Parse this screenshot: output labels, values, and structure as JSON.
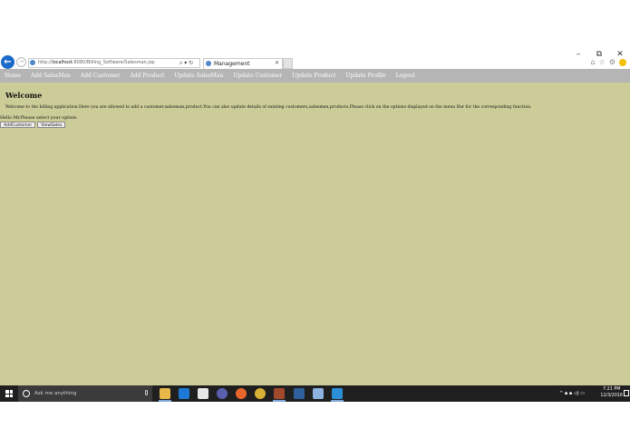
{
  "window_controls": {
    "minimize": "–",
    "restore": "⧉",
    "close": "✕"
  },
  "browser": {
    "back_icon": "←",
    "forward_icon": "→",
    "url_prefix": "http://",
    "url_host": "localhost",
    "url_rest": ":8080/Billing_Software/Salesman.jsp",
    "addr_actions": "⌕ ▾ ↻",
    "tab_title": "Management",
    "tab_close": "✕",
    "right_icons": [
      "⌂",
      "☆",
      "⚙"
    ]
  },
  "navbar": {
    "items": [
      "Home",
      "Add SalesMan",
      "Add Customer",
      "Add Product",
      "Update SalesMan",
      "Update Customer",
      "Update Product",
      "Update Profile",
      "Logout"
    ]
  },
  "page": {
    "title": "Welcome",
    "welcome_text": "Welcome to the billing application.Here you are allowed to add a customer,salesman,product.You can also update details of existing customers,salesmen,products.Please click on the options displayed on the menu Bar for the corresponding function.",
    "prompt": "Hello Mr.Please select your option:",
    "buttons": [
      "AddCustomer",
      "ViewSales"
    ]
  },
  "taskbar": {
    "search_placeholder": "Ask me anything",
    "tray_icons": "^ ▪ ▪ ◁) ▭",
    "time": "7:21 PM",
    "date": "12/3/2016"
  },
  "colors": {
    "page_bg": "#cccc99",
    "navbar_bg": "#b5b5b5",
    "taskbar_bg": "#1f1f1f",
    "accent": "#1b6ac9"
  }
}
